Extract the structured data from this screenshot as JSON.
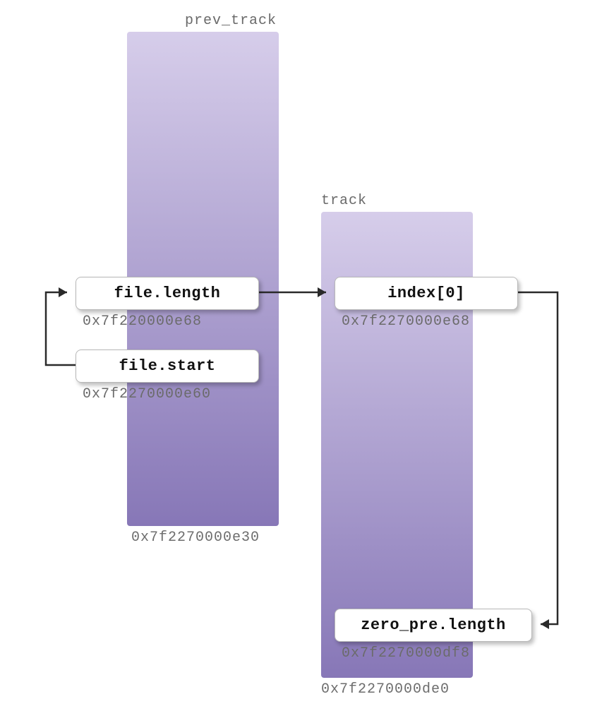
{
  "blocks": {
    "prev_track": {
      "label": "prev_track",
      "bottom_addr": "0x7f2270000e30"
    },
    "track": {
      "label": "track",
      "bottom_addr": "0x7f2270000de0"
    }
  },
  "nodes": {
    "file_length": {
      "label": "file.length",
      "addr": "0x7f220000e68"
    },
    "file_start": {
      "label": "file.start",
      "addr": "0x7f2270000e60"
    },
    "index0": {
      "label": "index[0]",
      "addr": "0x7f2270000e68"
    },
    "zero_pre_length": {
      "label": "zero_pre.length",
      "addr": "0x7f2270000df8"
    }
  }
}
